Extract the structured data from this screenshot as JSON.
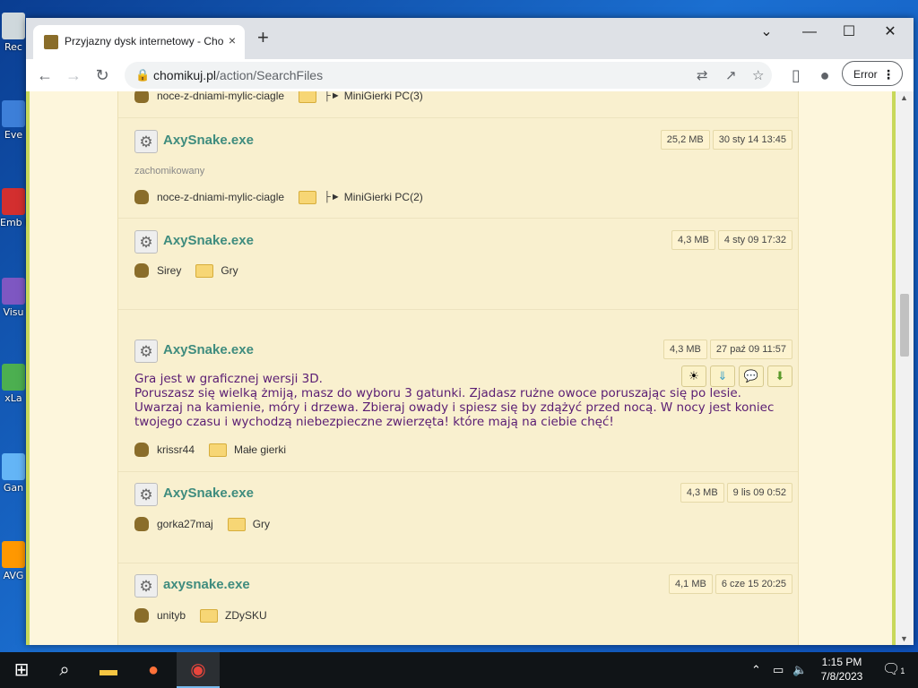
{
  "desktop": {
    "icons": [
      {
        "label": "Rec",
        "color": "#cfd8dc"
      },
      {
        "label": "Eve",
        "color": "#3d7fd8"
      },
      {
        "label": "Emb De",
        "color": "#d32f2f"
      },
      {
        "label": "Visu",
        "color": "#7e57c2"
      },
      {
        "label": "xLa",
        "color": "#4caf50"
      },
      {
        "label": "Gan",
        "color": "#64b5f6"
      },
      {
        "label": "AVG",
        "color": "#ff9800"
      }
    ]
  },
  "browser": {
    "tab_title": "Przyjazny dysk internetowy - Chomikuj.pl",
    "tab_close": "×",
    "new_tab": "+",
    "win_min": "⌄",
    "win_minimize": "—",
    "win_max": "☐",
    "win_close": "✕",
    "url_domain": "chomikuj.pl",
    "url_path": "/action/SearchFiles",
    "error_label": "Error",
    "error_menu": "⋮"
  },
  "results": [
    {
      "name": "",
      "owner": "noce-z-dniami-mylic-ciagle",
      "folder": "MiniGierki PC(3)",
      "folder_prefix": "├►"
    },
    {
      "name": "AxySnake.exe",
      "size": "25,2 MB",
      "date": "30 sty 14 13:45",
      "sub": "zachomikowany",
      "owner": "noce-z-dniami-mylic-ciagle",
      "folder": "MiniGierki PC(2)",
      "folder_prefix": "├►"
    },
    {
      "name": "AxySnake.exe",
      "size": "4,3 MB",
      "date": "4 sty 09 17:32",
      "owner": "Sirey",
      "folder": "Gry"
    },
    {
      "name": "AxySnake.exe",
      "size": "4,3 MB",
      "date": "27 paź 09 11:57",
      "description_line1": "Gra jest w graficznej wersji 3D.",
      "description_line2": "Poruszasz się wielką żmiją, masz do wyboru 3 gatunki. Zjadasz rużne owoce poruszając się po lesie. Uwarzaj na kamienie, móry i drzewa. Zbieraj owady i spiesz się by zdążyć przed nocą. W nocy jest koniec twojego czasu i wychodzą niebezpieczne zwierzęta! które mają na ciebie chęć!",
      "owner": "krissr44",
      "folder": "Małe gierki"
    },
    {
      "name": "AxySnake.exe",
      "size": "4,3 MB",
      "date": "9 lis 09 0:52",
      "owner": "gorka27maj",
      "folder": "Gry"
    },
    {
      "name": "axysnake.exe",
      "size": "4,1 MB",
      "date": "6 cze 15 20:25",
      "owner": "unityb",
      "folder": "ZDySKU"
    }
  ],
  "taskbar": {
    "time": "1:15 PM",
    "date": "7/8/2023",
    "notification_count": "1"
  },
  "colors": {
    "link": "#3f8c7e",
    "description": "#5a1d73",
    "frame": "#c8d85a",
    "content_bg": "#f9f0cf"
  }
}
